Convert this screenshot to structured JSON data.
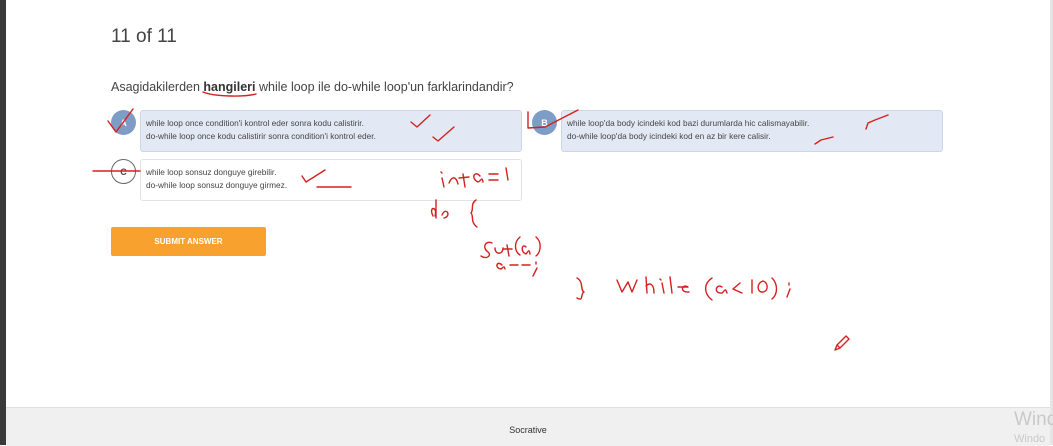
{
  "quiz": {
    "progress": "11 of 11",
    "question_prefix": "Asagidakilerden ",
    "question_keyword": "hangileri",
    "question_suffix": " while loop ile do-while loop'un farklarindandir?"
  },
  "answers": [
    {
      "letter": "A",
      "line1": "while loop once condition'i kontrol eder sonra kodu calistirir.",
      "line2": "do-while loop once kodu calistirir sonra condition'i kontrol eder.",
      "selected": true
    },
    {
      "letter": "B",
      "line1": "while loop'da body icindeki kod bazi durumlarda hic calismayabilir.",
      "line2": "do-while loop'da body icindeki kod en az bir kere calisir.",
      "selected": true
    },
    {
      "letter": "C",
      "line1": "while loop sonsuz donguye girebilir.",
      "line2": "do-while loop sonsuz donguye girmez.",
      "selected": false
    }
  ],
  "submit_label": "SUBMIT ANSWER",
  "footer_brand": "Socrative",
  "watermark": {
    "line1": "Wind",
    "line2": "Windo"
  },
  "colors": {
    "ink": "#d42020",
    "submit": "#f9a12f",
    "selected_bg": "#e3e9f4",
    "letter_bg": "#7d9dc6"
  }
}
